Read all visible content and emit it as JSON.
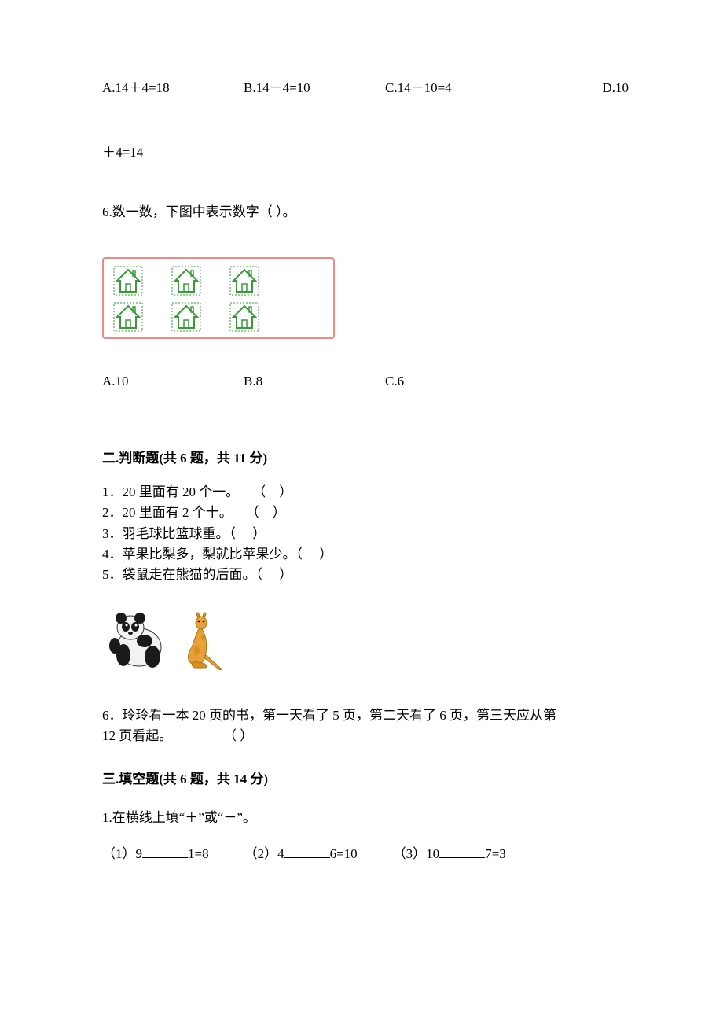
{
  "q5": {
    "opt_a": "A.14＋4=18",
    "opt_b": "B.14－4=10",
    "opt_c": "C.14－10=4",
    "opt_d": "D.10",
    "wrapped": "＋4=14"
  },
  "q6": {
    "text": "6.数一数，下图中表示数字（     ）。",
    "opt_a": "A.10",
    "opt_b": "B.8",
    "opt_c": "C.6"
  },
  "section2": {
    "header": "二.判断题(共 6 题，共 11 分)",
    "items": [
      "1．20 里面有 20 个一。    （    ）",
      "2．20 里面有 2 个十。    （    ）",
      "3．羽毛球比篮球重。（     ）",
      "4．苹果比梨多，梨就比苹果少。（     ）",
      "5．袋鼠走在熊猫的后面。（     ）"
    ],
    "item6_line1": "6．玲玲看一本 20 页的书，第一天看了 5 页，第二天看了 6 页，第三天应从第",
    "item6_line2_pre": "12 页看起。",
    "item6_paren": "（     ）"
  },
  "section3": {
    "header": "三.填空题(共 6 题，共 14 分)",
    "q1": "1.在横线上填“＋”或“－”。",
    "blanks": {
      "b1_pre": "（1）9",
      "b1_post": "1=8",
      "b2_pre": "（2）4",
      "b2_post": "6=10",
      "b3_pre": "（3）10",
      "b3_post": "7=3"
    }
  }
}
